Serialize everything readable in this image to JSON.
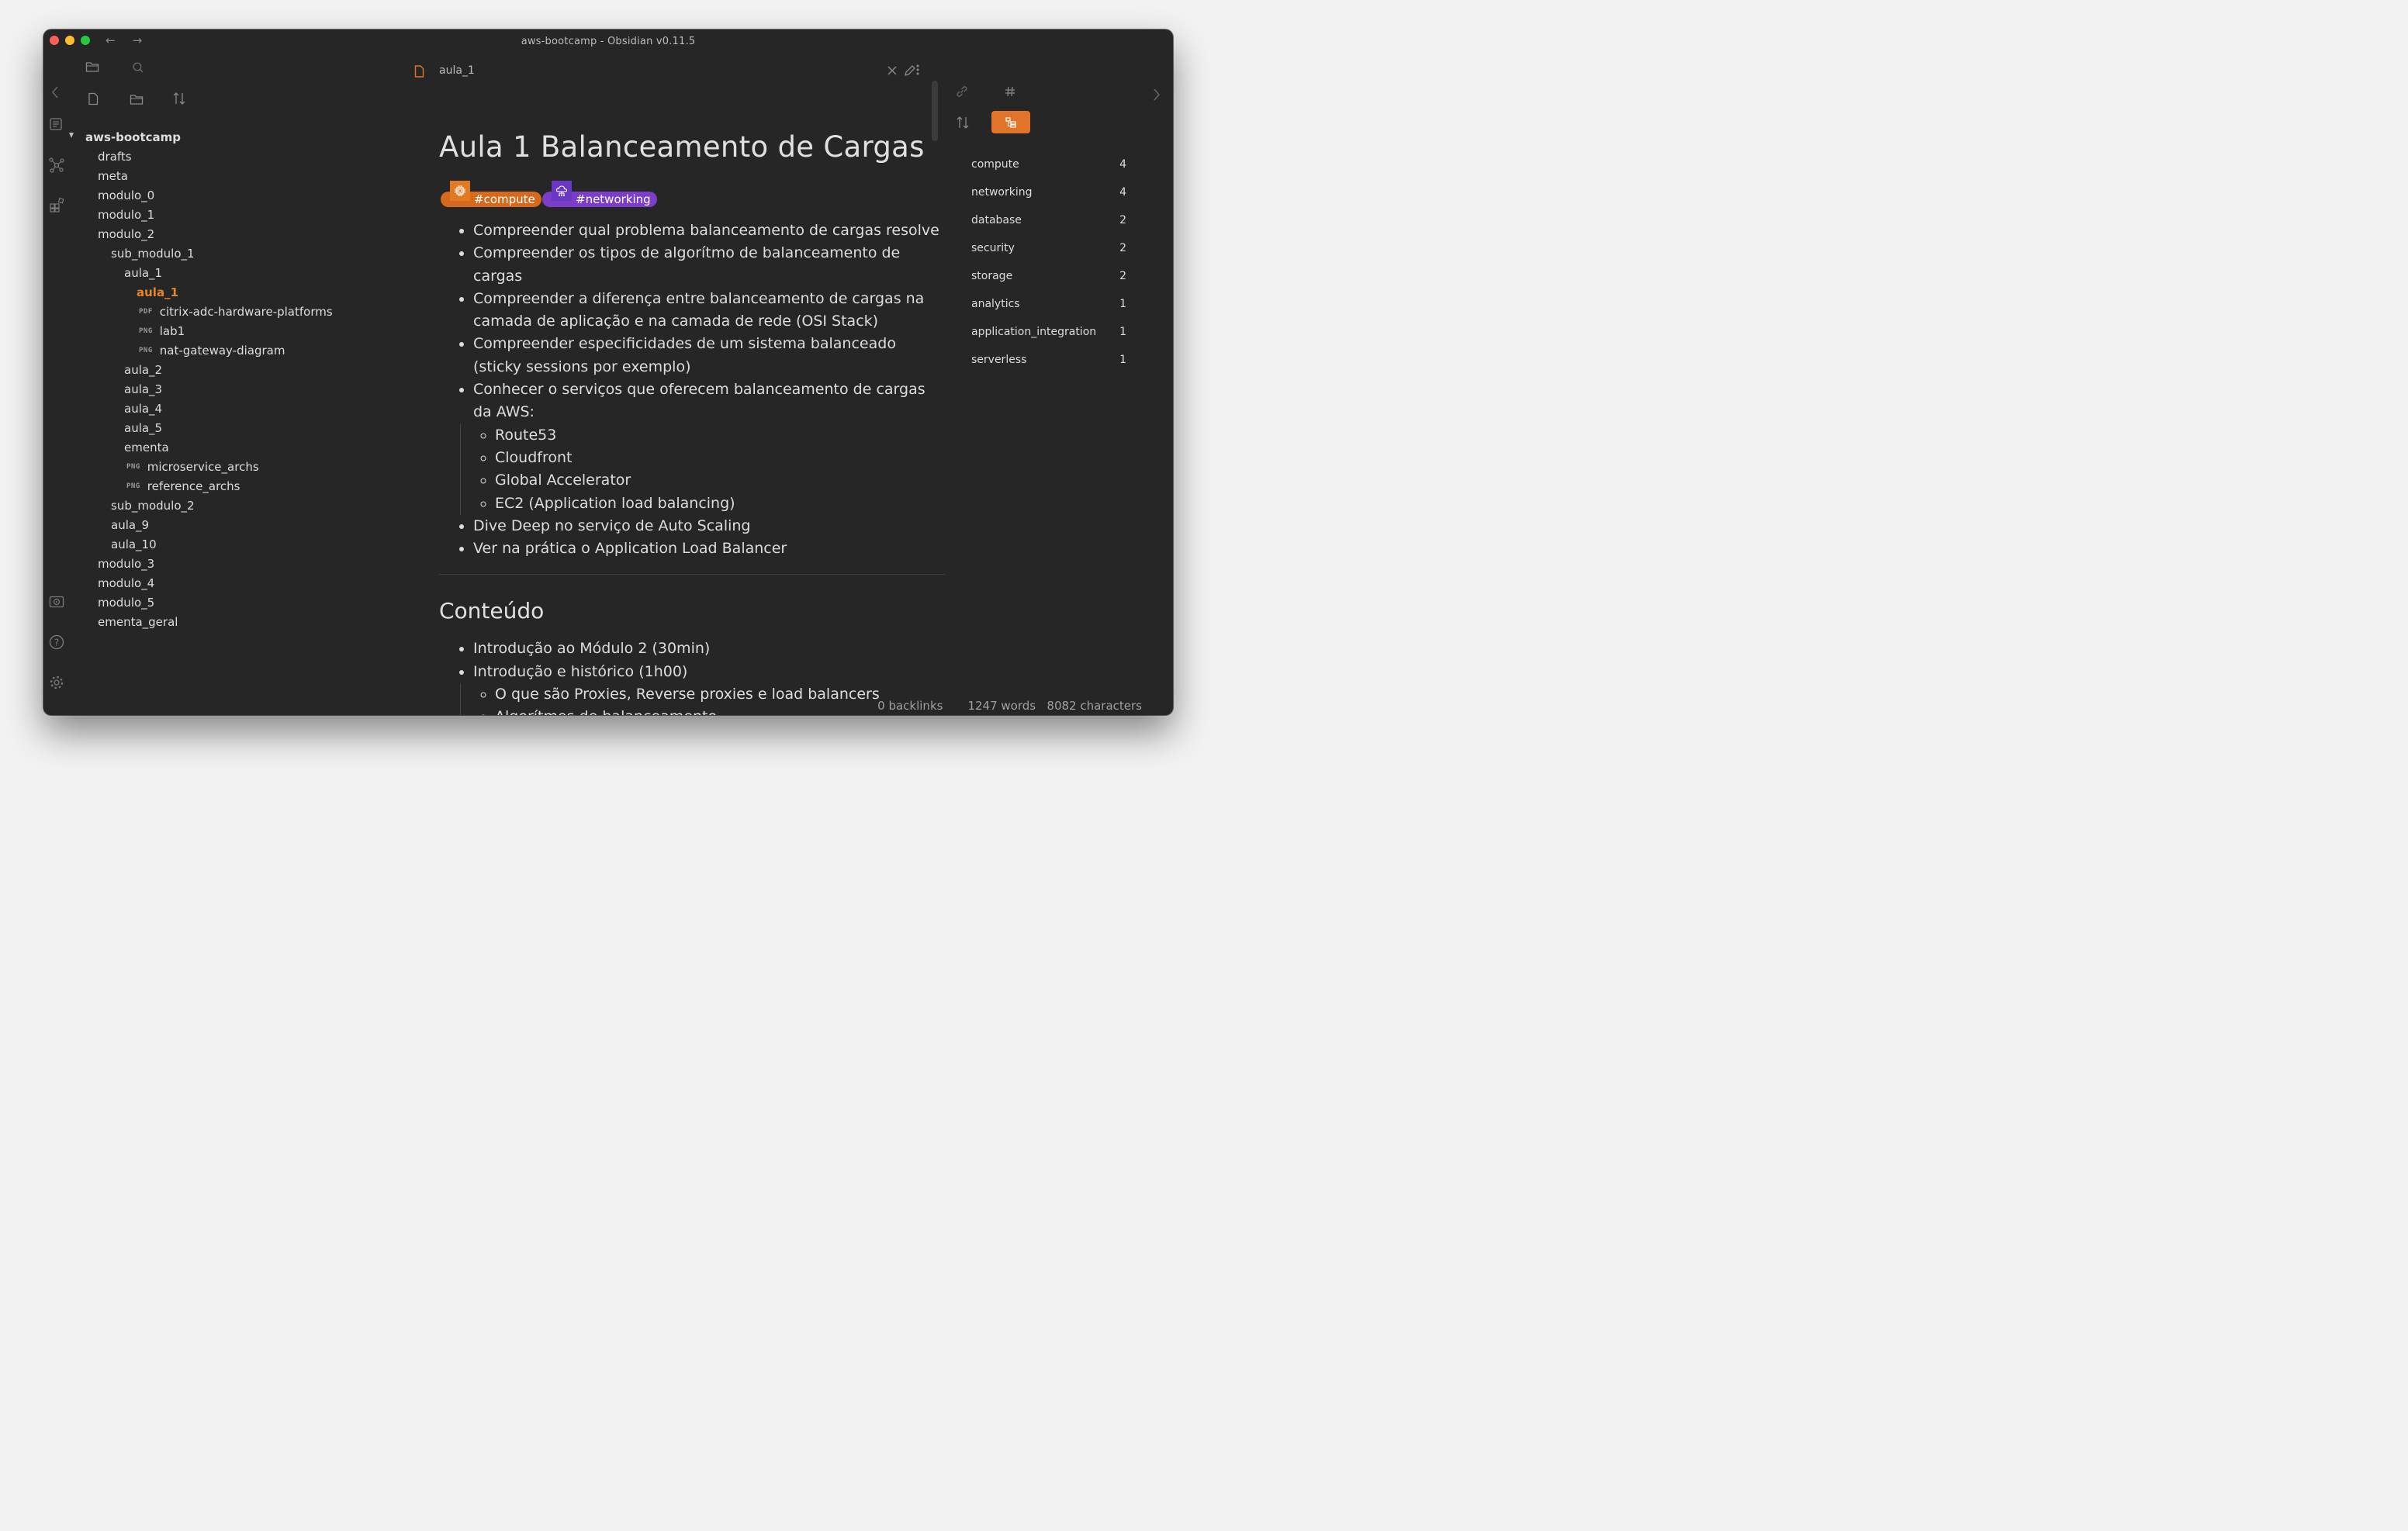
{
  "window": {
    "title": "aws-bootcamp - Obsidian v0.11.5"
  },
  "nav": {
    "back_icon": "arrow-left-icon",
    "forward_icon": "arrow-right-icon"
  },
  "file_tree": {
    "root": "aws-bootcamp",
    "items": [
      {
        "label": "drafts",
        "indent": 1
      },
      {
        "label": "meta",
        "indent": 1
      },
      {
        "label": "modulo_0",
        "indent": 1
      },
      {
        "label": "modulo_1",
        "indent": 1
      },
      {
        "label": "modulo_2",
        "indent": 1
      },
      {
        "label": "sub_modulo_1",
        "indent": 2
      },
      {
        "label": "aula_1",
        "indent": 3
      },
      {
        "label": "aula_1",
        "indent": 4,
        "active": true
      },
      {
        "label": "citrix-adc-hardware-platforms",
        "indent": 4,
        "ext": "PDF"
      },
      {
        "label": "lab1",
        "indent": 4,
        "ext": "PNG"
      },
      {
        "label": "nat-gateway-diagram",
        "indent": 4,
        "ext": "PNG"
      },
      {
        "label": "aula_2",
        "indent": 3
      },
      {
        "label": "aula_3",
        "indent": 3
      },
      {
        "label": "aula_4",
        "indent": 3
      },
      {
        "label": "aula_5",
        "indent": 3
      },
      {
        "label": "ementa",
        "indent": 3
      },
      {
        "label": "microservice_archs",
        "indent": 3,
        "ext": "PNG"
      },
      {
        "label": "reference_archs",
        "indent": 3,
        "ext": "PNG"
      },
      {
        "label": "sub_modulo_2",
        "indent": 2
      },
      {
        "label": "aula_9",
        "indent": 2
      },
      {
        "label": "aula_10",
        "indent": 2
      },
      {
        "label": "modulo_3",
        "indent": 1
      },
      {
        "label": "modulo_4",
        "indent": 1
      },
      {
        "label": "modulo_5",
        "indent": 1
      },
      {
        "label": "ementa_geral",
        "indent": 1
      }
    ]
  },
  "editor": {
    "tab_title": "aula_1",
    "heading": "Aula 1 Balanceamento de Cargas",
    "tags": [
      {
        "label": "#compute",
        "color": "#d5691e",
        "icon": "chip-icon"
      },
      {
        "label": "#networking",
        "color": "#7c3ec8",
        "icon": "cloud-network-icon"
      }
    ],
    "bullets": [
      "Compreender qual problema balanceamento de cargas resolve",
      "Compreender os tipos de algorítmo de balanceamento de cargas",
      "Compreender a diferença entre balanceamento de cargas na camada de aplicação e na camada de rede (OSI Stack)",
      "Compreender especificidades de um sistema balanceado (sticky sessions por exemplo)",
      "Conhecer o serviços que oferecem balanceamento de cargas da AWS:"
    ],
    "aws_services": [
      "Route53",
      "Cloudfront",
      "Global Accelerator",
      "EC2 (Application load balancing)"
    ],
    "bullets_after": [
      "Dive Deep no serviço de Auto Scaling",
      "Ver na prática o Application Load Balancer"
    ],
    "section_heading": "Conteúdo",
    "content_bullets": [
      "Introdução ao Módulo 2 (30min)",
      "Introdução e histórico (1h00)"
    ],
    "content_sub": [
      "O que são Proxies, Reverse proxies e load balancers",
      "Algorítmos de balanceamento"
    ]
  },
  "tag_pane": {
    "accent": "#e2742a",
    "items": [
      {
        "name": "compute",
        "count": "4"
      },
      {
        "name": "networking",
        "count": "4"
      },
      {
        "name": "database",
        "count": "2"
      },
      {
        "name": "security",
        "count": "2"
      },
      {
        "name": "storage",
        "count": "2"
      },
      {
        "name": "analytics",
        "count": "1"
      },
      {
        "name": "application_integration",
        "count": "1"
      },
      {
        "name": "serverless",
        "count": "1"
      }
    ]
  },
  "status": {
    "backlinks": "0 backlinks",
    "words": "1247 words",
    "characters": "8082 characters"
  }
}
